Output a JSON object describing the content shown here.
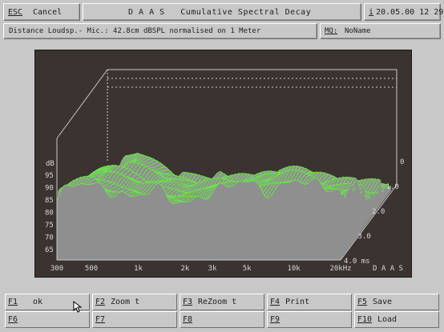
{
  "header": {
    "esc_key": "ESC",
    "esc_label": "Cancel",
    "title": "D A A S   Cumulative Spectral Decay",
    "info_icon": "i",
    "datetime": "20.05.00 12 29"
  },
  "info_bar": {
    "text": "Distance Loudsp.- Mic.: 42.8cm dBSPL normalised on 1 Meter",
    "meas_key": "MQ:",
    "meas_value": "NoName"
  },
  "plot": {
    "y_unit": "dB",
    "y_ticks": [
      "95",
      "90",
      "85",
      "80",
      "75",
      "70",
      "65"
    ],
    "x_ticks": [
      "300",
      "500",
      "1k",
      "2k",
      "3k",
      "5k",
      "10k",
      "20kHz"
    ],
    "z_ticks": [
      "0",
      "1.0",
      "2.0",
      "3.0",
      "4.0 ms"
    ],
    "brand": "D A A S",
    "colors": {
      "trace": "#66ee44",
      "background": "#3a3330",
      "grid": "#c8c8c8"
    },
    "z_range_ms": [
      0,
      4
    ],
    "y_range_db": [
      65,
      100
    ],
    "x_range_hz": [
      300,
      20000
    ],
    "x_scale": "log"
  },
  "function_keys": [
    {
      "key": "F1",
      "label": "  ok"
    },
    {
      "key": "F2",
      "label": "Zoom t"
    },
    {
      "key": "F3",
      "label": "ReZoom t"
    },
    {
      "key": "F4",
      "label": "Print"
    },
    {
      "key": "F5",
      "label": "Save"
    },
    {
      "key": "F6",
      "label": ""
    },
    {
      "key": "F7",
      "label": ""
    },
    {
      "key": "F8",
      "label": ""
    },
    {
      "key": "F9",
      "label": ""
    },
    {
      "key": "F10",
      "label": "Load"
    }
  ]
}
